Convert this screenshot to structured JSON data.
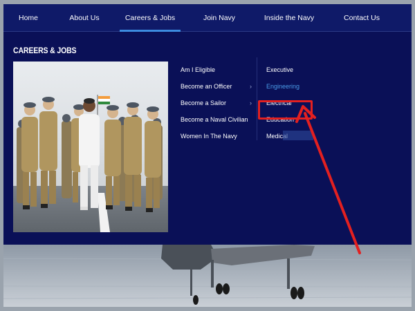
{
  "nav": {
    "items": [
      {
        "label": "Home",
        "active": false
      },
      {
        "label": "About Us",
        "active": false
      },
      {
        "label": "Careers & Jobs",
        "active": true
      },
      {
        "label": "Join Navy",
        "active": false
      },
      {
        "label": "Inside the Navy",
        "active": false
      },
      {
        "label": "Contact Us",
        "active": false
      }
    ]
  },
  "panel": {
    "title": "CAREERS & JOBS",
    "menu": [
      {
        "label": "Am I Eligible",
        "has_submenu": false
      },
      {
        "label": "Become an Officer",
        "has_submenu": true
      },
      {
        "label": "Become a Sailor",
        "has_submenu": true
      },
      {
        "label": "Become a Naval Civilian",
        "has_submenu": false
      },
      {
        "label": "Women In The Navy",
        "has_submenu": false
      }
    ],
    "submenu": [
      {
        "label": "Executive",
        "highlighted": false
      },
      {
        "label": "Engineering",
        "highlighted": true
      },
      {
        "label": "Electrical",
        "highlighted": false
      },
      {
        "label": "Education",
        "highlighted": false
      },
      {
        "label": "Medical",
        "highlighted": false
      }
    ],
    "submenu_chevron": "›"
  },
  "colors": {
    "nav_bg": "#0f1a68",
    "panel_bg": "#0a1057",
    "active_underline": "#3d8ce0",
    "link_highlight": "#4a9be8",
    "annotation_red": "#e32020"
  },
  "icons": {
    "submenu_indicator": "chevron-right-icon",
    "annotation": "red-arrow-annotation"
  }
}
